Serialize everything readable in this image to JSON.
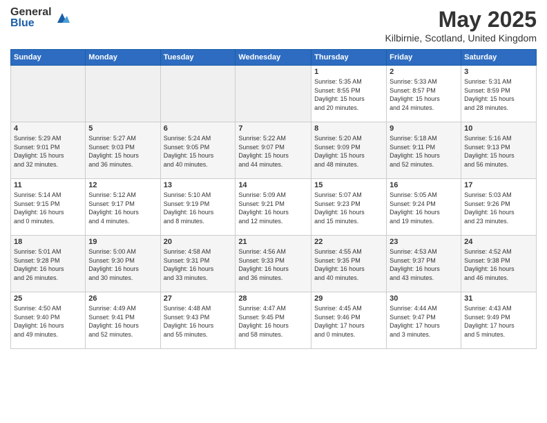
{
  "logo": {
    "general": "General",
    "blue": "Blue"
  },
  "title": "May 2025",
  "location": "Kilbirnie, Scotland, United Kingdom",
  "weekdays": [
    "Sunday",
    "Monday",
    "Tuesday",
    "Wednesday",
    "Thursday",
    "Friday",
    "Saturday"
  ],
  "weeks": [
    [
      {
        "day": "",
        "empty": true
      },
      {
        "day": "",
        "empty": true
      },
      {
        "day": "",
        "empty": true
      },
      {
        "day": "",
        "empty": true
      },
      {
        "day": "1",
        "sunrise": "5:35 AM",
        "sunset": "8:55 PM",
        "daylight": "15 hours and 20 minutes."
      },
      {
        "day": "2",
        "sunrise": "5:33 AM",
        "sunset": "8:57 PM",
        "daylight": "15 hours and 24 minutes."
      },
      {
        "day": "3",
        "sunrise": "5:31 AM",
        "sunset": "8:59 PM",
        "daylight": "15 hours and 28 minutes."
      }
    ],
    [
      {
        "day": "4",
        "sunrise": "5:29 AM",
        "sunset": "9:01 PM",
        "daylight": "15 hours and 32 minutes."
      },
      {
        "day": "5",
        "sunrise": "5:27 AM",
        "sunset": "9:03 PM",
        "daylight": "15 hours and 36 minutes."
      },
      {
        "day": "6",
        "sunrise": "5:24 AM",
        "sunset": "9:05 PM",
        "daylight": "15 hours and 40 minutes."
      },
      {
        "day": "7",
        "sunrise": "5:22 AM",
        "sunset": "9:07 PM",
        "daylight": "15 hours and 44 minutes."
      },
      {
        "day": "8",
        "sunrise": "5:20 AM",
        "sunset": "9:09 PM",
        "daylight": "15 hours and 48 minutes."
      },
      {
        "day": "9",
        "sunrise": "5:18 AM",
        "sunset": "9:11 PM",
        "daylight": "15 hours and 52 minutes."
      },
      {
        "day": "10",
        "sunrise": "5:16 AM",
        "sunset": "9:13 PM",
        "daylight": "15 hours and 56 minutes."
      }
    ],
    [
      {
        "day": "11",
        "sunrise": "5:14 AM",
        "sunset": "9:15 PM",
        "daylight": "16 hours and 0 minutes."
      },
      {
        "day": "12",
        "sunrise": "5:12 AM",
        "sunset": "9:17 PM",
        "daylight": "16 hours and 4 minutes."
      },
      {
        "day": "13",
        "sunrise": "5:10 AM",
        "sunset": "9:19 PM",
        "daylight": "16 hours and 8 minutes."
      },
      {
        "day": "14",
        "sunrise": "5:09 AM",
        "sunset": "9:21 PM",
        "daylight": "16 hours and 12 minutes."
      },
      {
        "day": "15",
        "sunrise": "5:07 AM",
        "sunset": "9:23 PM",
        "daylight": "16 hours and 15 minutes."
      },
      {
        "day": "16",
        "sunrise": "5:05 AM",
        "sunset": "9:24 PM",
        "daylight": "16 hours and 19 minutes."
      },
      {
        "day": "17",
        "sunrise": "5:03 AM",
        "sunset": "9:26 PM",
        "daylight": "16 hours and 23 minutes."
      }
    ],
    [
      {
        "day": "18",
        "sunrise": "5:01 AM",
        "sunset": "9:28 PM",
        "daylight": "16 hours and 26 minutes."
      },
      {
        "day": "19",
        "sunrise": "5:00 AM",
        "sunset": "9:30 PM",
        "daylight": "16 hours and 30 minutes."
      },
      {
        "day": "20",
        "sunrise": "4:58 AM",
        "sunset": "9:31 PM",
        "daylight": "16 hours and 33 minutes."
      },
      {
        "day": "21",
        "sunrise": "4:56 AM",
        "sunset": "9:33 PM",
        "daylight": "16 hours and 36 minutes."
      },
      {
        "day": "22",
        "sunrise": "4:55 AM",
        "sunset": "9:35 PM",
        "daylight": "16 hours and 40 minutes."
      },
      {
        "day": "23",
        "sunrise": "4:53 AM",
        "sunset": "9:37 PM",
        "daylight": "16 hours and 43 minutes."
      },
      {
        "day": "24",
        "sunrise": "4:52 AM",
        "sunset": "9:38 PM",
        "daylight": "16 hours and 46 minutes."
      }
    ],
    [
      {
        "day": "25",
        "sunrise": "4:50 AM",
        "sunset": "9:40 PM",
        "daylight": "16 hours and 49 minutes."
      },
      {
        "day": "26",
        "sunrise": "4:49 AM",
        "sunset": "9:41 PM",
        "daylight": "16 hours and 52 minutes."
      },
      {
        "day": "27",
        "sunrise": "4:48 AM",
        "sunset": "9:43 PM",
        "daylight": "16 hours and 55 minutes."
      },
      {
        "day": "28",
        "sunrise": "4:47 AM",
        "sunset": "9:45 PM",
        "daylight": "16 hours and 58 minutes."
      },
      {
        "day": "29",
        "sunrise": "4:45 AM",
        "sunset": "9:46 PM",
        "daylight": "17 hours and 0 minutes."
      },
      {
        "day": "30",
        "sunrise": "4:44 AM",
        "sunset": "9:47 PM",
        "daylight": "17 hours and 3 minutes."
      },
      {
        "day": "31",
        "sunrise": "4:43 AM",
        "sunset": "9:49 PM",
        "daylight": "17 hours and 5 minutes."
      }
    ]
  ],
  "labels": {
    "sunrise": "Sunrise:",
    "sunset": "Sunset:",
    "daylight": "Daylight:"
  }
}
